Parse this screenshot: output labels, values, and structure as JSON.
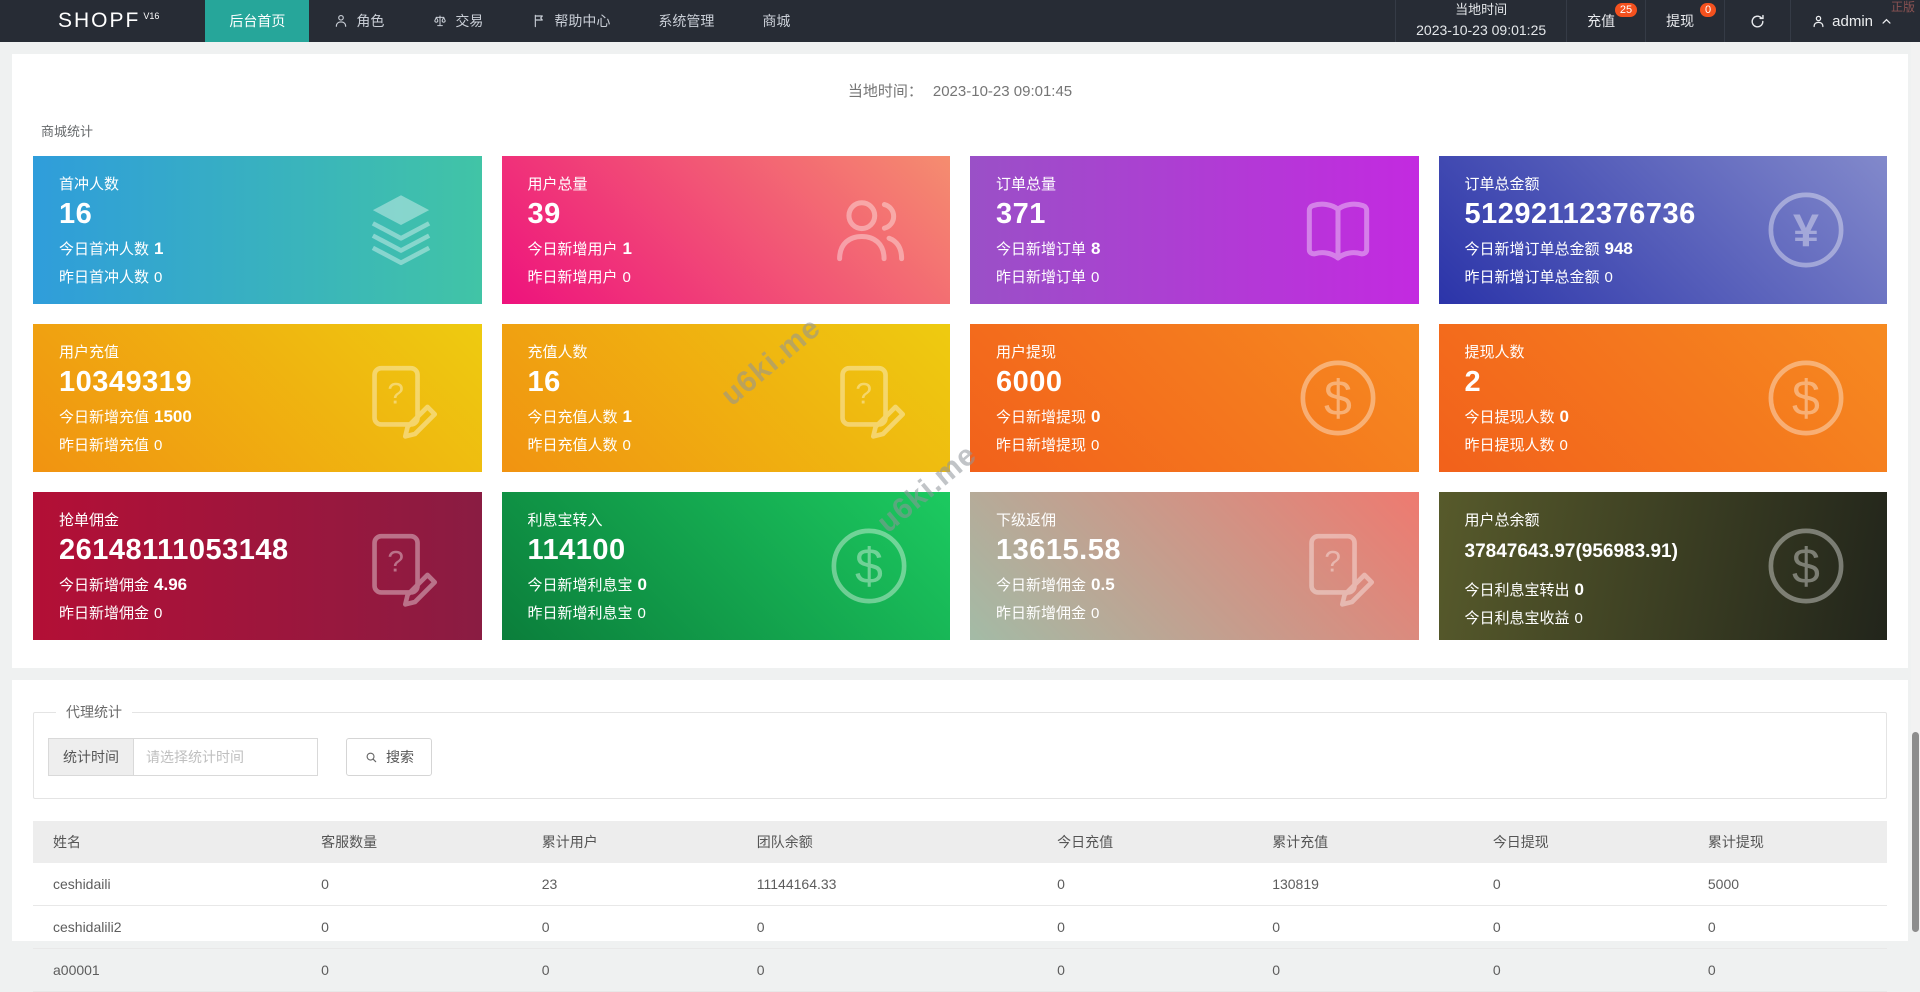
{
  "navbar": {
    "logo": "SHOPF",
    "logo_sup": "V16",
    "items": [
      {
        "label": "后台首页",
        "icon": "",
        "active": true
      },
      {
        "label": "角色",
        "icon": "person-icon",
        "active": false
      },
      {
        "label": "交易",
        "icon": "scales-icon",
        "active": false
      },
      {
        "label": "帮助中心",
        "icon": "flag-icon",
        "active": false
      },
      {
        "label": "系统管理",
        "icon": "",
        "active": false
      },
      {
        "label": "商城",
        "icon": "",
        "active": false
      }
    ],
    "local_time_label": "当地时间",
    "local_time_value": "2023-10-23 09:01:25",
    "recharge_label": "充值",
    "recharge_badge": "25",
    "withdraw_label": "提现",
    "withdraw_badge": "0",
    "username": "admin",
    "corner_text": "正版",
    "active_color": "#26a69a",
    "badge_color": "#f4511e"
  },
  "main": {
    "time_label": "当地时间：",
    "time_value": "2023-10-23 09:01:45",
    "stats_title": "商城统计",
    "cards": [
      {
        "title": "首冲人数",
        "value": "16",
        "line1_label": "今日首冲人数",
        "line1_value": "1",
        "line2_label": "昨日首冲人数",
        "line2_value": "0",
        "icon": "layers-icon",
        "color_from": "#2f9ddb",
        "color_to": "#41c4a6",
        "angle": "90deg",
        "small_value": false
      },
      {
        "title": "用户总量",
        "value": "39",
        "line1_label": "今日新增用户",
        "line1_value": "1",
        "line2_label": "昨日新增用户",
        "line2_value": "0",
        "icon": "users-icon",
        "color_from": "#ee127d",
        "color_to": "#f58d6f",
        "angle": "45deg",
        "small_value": false
      },
      {
        "title": "订单总量",
        "value": "371",
        "line1_label": "今日新增订单",
        "line1_value": "8",
        "line2_label": "昨日新增订单",
        "line2_value": "0",
        "icon": "book-icon",
        "color_from": "#9a50c7",
        "color_to": "#c32ae0",
        "angle": "90deg",
        "small_value": false
      },
      {
        "title": "订单总金额",
        "value": "51292112376736",
        "line1_label": "今日新增订单总金额",
        "line1_value": "948",
        "line2_label": "昨日新增订单总金额",
        "line2_value": "0",
        "icon": "yen-circle-icon",
        "color_from": "#2b34a9",
        "color_to": "#8289cb",
        "angle": "45deg",
        "small_value": false
      },
      {
        "title": "用户充值",
        "value": "10349319",
        "line1_label": "今日新增充值",
        "line1_value": "1500",
        "line2_label": "昨日新增充值",
        "line2_value": "0",
        "icon": "document-edit-icon",
        "color_from": "#f19311",
        "color_to": "#eecb10",
        "angle": "45deg",
        "small_value": false
      },
      {
        "title": "充值人数",
        "value": "16",
        "line1_label": "今日充值人数",
        "line1_value": "1",
        "line2_label": "昨日充值人数",
        "line2_value": "0",
        "icon": "document-edit-icon",
        "color_from": "#f19311",
        "color_to": "#eecb10",
        "angle": "45deg",
        "small_value": false
      },
      {
        "title": "用户提现",
        "value": "6000",
        "line1_label": "今日新增提现",
        "line1_value": "0",
        "line2_label": "昨日新增提现",
        "line2_value": "0",
        "icon": "dollar-circle-icon",
        "color_from": "#f2611b",
        "color_to": "#f68a20",
        "angle": "45deg",
        "small_value": false
      },
      {
        "title": "提现人数",
        "value": "2",
        "line1_label": "今日提现人数",
        "line1_value": "0",
        "line2_label": "昨日提现人数",
        "line2_value": "0",
        "icon": "dollar-circle-icon",
        "color_from": "#f2611b",
        "color_to": "#f68a20",
        "angle": "45deg",
        "small_value": false
      },
      {
        "title": "抢单佣金",
        "value": "26148111053148",
        "line1_label": "今日新增佣金",
        "line1_value": "4.96",
        "line2_label": "昨日新增佣金",
        "line2_value": "0",
        "icon": "document-edit-icon",
        "color_from": "#b30f36",
        "color_to": "#8a1c42",
        "angle": "90deg",
        "small_value": false
      },
      {
        "title": "利息宝转入",
        "value": "114100",
        "line1_label": "今日新增利息宝",
        "line1_value": "0",
        "line2_label": "昨日新增利息宝",
        "line2_value": "0",
        "icon": "dollar-circle-icon",
        "color_from": "#0b7e3b",
        "color_to": "#1cca60",
        "angle": "45deg",
        "small_value": false
      },
      {
        "title": "下级返佣",
        "value": "13615.58",
        "line1_label": "今日新增佣金",
        "line1_value": "0.5",
        "line2_label": "昨日新增佣金",
        "line2_value": "0",
        "icon": "document-edit-icon",
        "color_from": "#a3bba6",
        "color_to": "#ee7a70",
        "angle": "45deg",
        "small_value": false
      },
      {
        "title": "用户总余额",
        "value": "37847643.97(956983.91)",
        "line1_label": "今日利息宝转出",
        "line1_value": "0",
        "line2_label": "今日利息宝收益",
        "line2_value": "0",
        "icon": "dollar-circle-icon",
        "color_from": "#575a2b",
        "color_to": "#22251b",
        "angle": "100deg",
        "small_value": true
      }
    ]
  },
  "agent": {
    "legend": "代理统计",
    "time_label": "统计时间",
    "time_placeholder": "请选择统计时间",
    "search_label": "搜索",
    "table": {
      "headers": [
        "姓名",
        "客服数量",
        "累计用户",
        "团队余额",
        "今日充值",
        "累计充值",
        "今日提现",
        "累计提现"
      ],
      "col_widths": [
        "15%",
        "11.9%",
        "11.6%",
        "16.2%",
        "11.6%",
        "11.9%",
        "11.6%",
        "10.2%"
      ],
      "rows": [
        [
          "ceshidaili",
          "0",
          "23",
          "11144164.33",
          "0",
          "130819",
          "0",
          "5000"
        ],
        [
          "ceshidalili2",
          "0",
          "0",
          "0",
          "0",
          "0",
          "0",
          "0"
        ],
        [
          "a00001",
          "0",
          "0",
          "0",
          "0",
          "0",
          "0",
          "0"
        ]
      ]
    }
  },
  "watermark_text": "u6ki.me"
}
